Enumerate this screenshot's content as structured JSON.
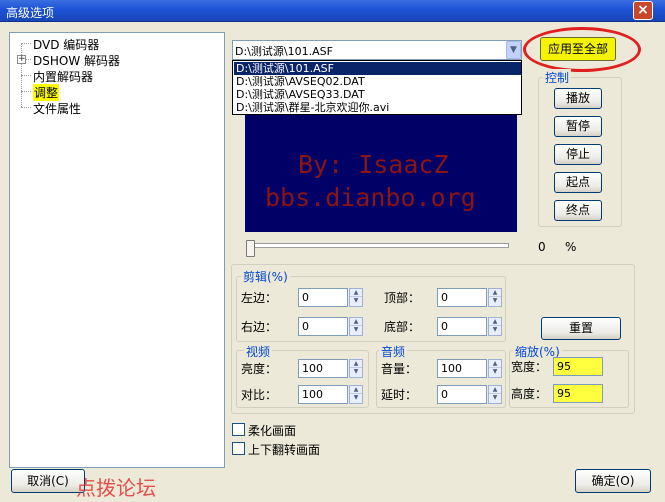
{
  "window": {
    "title": "高级选项",
    "close_glyph": "×"
  },
  "tree": {
    "items": [
      {
        "label": "DVD 编码器",
        "expandable": false
      },
      {
        "label": "DSHOW 解码器",
        "expandable": true,
        "expand_glyph": "+"
      },
      {
        "label": "内置解码器",
        "expandable": false
      },
      {
        "label": "调整",
        "expandable": false,
        "selected": true
      },
      {
        "label": "文件属性",
        "expandable": false
      }
    ]
  },
  "source": {
    "current_value": "D:\\测试源\\101.ASF",
    "dropdown_arrow": "▼",
    "options": [
      "D:\\测试源\\101.ASF",
      "D:\\测试源\\AVSEQ02.DAT",
      "D:\\测试源\\AVSEQ33.DAT",
      "D:\\测试源\\群星-北京欢迎你.avi"
    ],
    "selected_index": 0
  },
  "apply_all_label": "应用至全部",
  "video": {
    "watermark_line1": "By: IsaacZ",
    "watermark_line2": "bbs.dianbo.org"
  },
  "playback": {
    "title": "控制",
    "buttons": [
      "播放",
      "暂停",
      "停止",
      "起点",
      "终点"
    ]
  },
  "progress": {
    "value": "0",
    "unit": "%",
    "fraction": 0
  },
  "crop": {
    "title": "剪辑(%)",
    "fields": [
      {
        "label": "左边：",
        "value": "0"
      },
      {
        "label": "顶部：",
        "value": "0"
      },
      {
        "label": "右边：",
        "value": "0"
      },
      {
        "label": "底部：",
        "value": "0"
      }
    ]
  },
  "reset_label": "重置",
  "video_group": {
    "title": "视频",
    "fields": [
      {
        "label": "亮度：",
        "value": "100"
      },
      {
        "label": "对比：",
        "value": "100"
      }
    ]
  },
  "audio_group": {
    "title": "音频",
    "fields": [
      {
        "label": "音量：",
        "value": "100"
      },
      {
        "label": "延时：",
        "value": "0"
      }
    ]
  },
  "scale_group": {
    "title": "缩放(%)",
    "fields": [
      {
        "label": "宽度：",
        "value": "95"
      },
      {
        "label": "高度：",
        "value": "95"
      }
    ]
  },
  "checkboxes": [
    {
      "label": "柔化画面",
      "checked": false
    },
    {
      "label": "上下翻转画面",
      "checked": false
    }
  ],
  "cancel_label": "取消(C)",
  "ok_label": "确定(O)",
  "forum_watermark": "点拨论坛",
  "colors": {
    "highlight_ring": "#e02020",
    "apply_button": "#f4f400",
    "video_background": "#000066",
    "watermark_text": "#8b1414",
    "group_title": "#0046d5",
    "tree_selection": "#ffff00",
    "scale_fields": "#ffff40"
  }
}
